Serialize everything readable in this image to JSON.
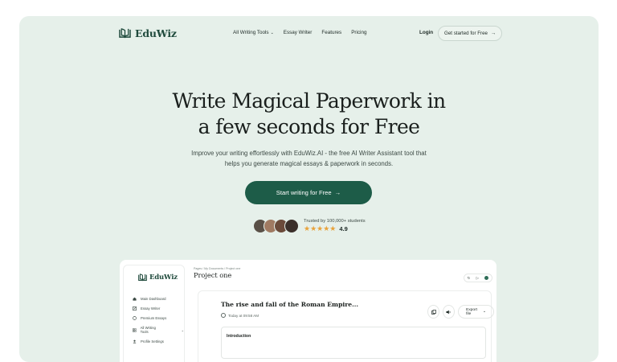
{
  "brand": {
    "name": "EduWiz",
    "color": "#1d5c48"
  },
  "nav": {
    "links": [
      {
        "label": "All Writing Tools",
        "dropdown": true
      },
      {
        "label": "Essay Writer"
      },
      {
        "label": "Features"
      },
      {
        "label": "Pricing"
      }
    ],
    "login": "Login",
    "cta": "Get started for Free",
    "cta_arrow": "→"
  },
  "hero": {
    "title_line1": "Write Magical Paperwork in",
    "title_line2": "a few seconds for Free",
    "subtitle_line1": "Improve your writing effortlessly with EduWiz.AI - the free AI Writer Assistant tool that",
    "subtitle_line2": "helps you generate magical essays & paperwork in seconds.",
    "button": "Start writing for Free",
    "button_arrow": "→"
  },
  "trust": {
    "label": "Trusted by 100,000+ students",
    "stars": "★★★★★",
    "rating": "4.9",
    "avatar_colors": [
      "#5a5047",
      "#a07a62",
      "#6b4a3a",
      "#3b2f2a"
    ]
  },
  "app_preview": {
    "sidebar": {
      "logo": "EduWiz",
      "items": [
        {
          "label": "Main Dashboard",
          "icon": "home-icon"
        },
        {
          "label": "Essay Writer",
          "icon": "edit-icon"
        },
        {
          "label": "Premium Essays",
          "icon": "badge-icon"
        },
        {
          "label": "All Writing Tools",
          "icon": "grid-icon",
          "dropdown": true
        },
        {
          "label": "Profile Settings",
          "icon": "user-settings-icon"
        }
      ]
    },
    "breadcrumb": "Pages / My Documents / Project one",
    "project_title": "Project one",
    "tools": {
      "refresh": "↻",
      "play": "▷"
    },
    "document": {
      "title": "The rise and fall of the Roman Empire...",
      "timestamp": "Today at 09:58 AM",
      "export_label": "Export file",
      "section_label": "Introduction"
    }
  }
}
